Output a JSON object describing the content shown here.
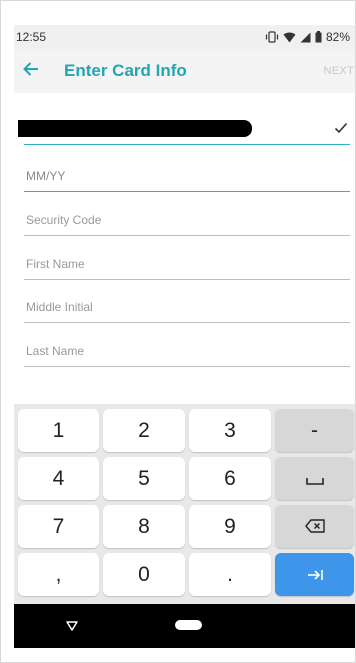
{
  "status_bar": {
    "time": "12:55",
    "battery_percent": "82%",
    "icons": [
      "vibrate-icon",
      "wifi-icon",
      "signal-icon",
      "battery-icon"
    ]
  },
  "app_bar": {
    "back_icon": "arrow-left-icon",
    "title": "Enter Card Info",
    "next_label": "NEXT"
  },
  "form": {
    "card_number": {
      "value_redacted": true,
      "valid_icon": "check-icon"
    },
    "expiry": {
      "placeholder": "MM/YY",
      "value": ""
    },
    "security_code": {
      "placeholder": "Security Code",
      "value": ""
    },
    "first_name": {
      "placeholder": "First Name",
      "value": ""
    },
    "middle_initial": {
      "placeholder": "Middle Initial",
      "value": ""
    },
    "last_name": {
      "placeholder": "Last Name",
      "value": ""
    }
  },
  "keyboard": {
    "rows": [
      [
        "1",
        "2",
        "3",
        "-"
      ],
      [
        "4",
        "5",
        "6",
        "space-icon"
      ],
      [
        "7",
        "8",
        "9",
        "backspace-icon"
      ],
      [
        ",",
        "0",
        ".",
        "tab-next-icon"
      ]
    ]
  },
  "nav_bar": {
    "icons": [
      "nav-back-icon",
      "nav-home-icon"
    ]
  },
  "colors": {
    "accent": "#22a6b3",
    "action_key": "#3d96ea"
  }
}
